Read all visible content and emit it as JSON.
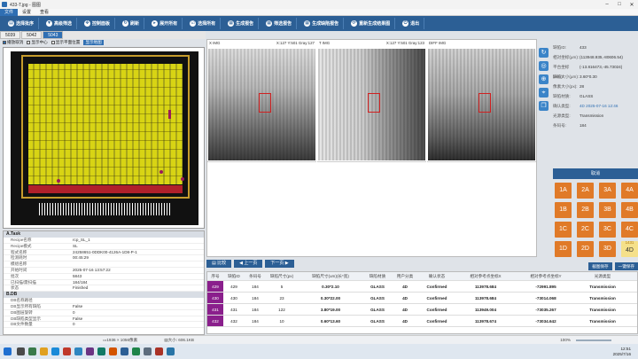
{
  "window": {
    "title": "433-T.jpg - 图图",
    "controls": [
      "–",
      "□",
      "✕"
    ]
  },
  "menu": {
    "items": [
      "文件",
      "设置",
      "查看"
    ],
    "active_index": 0
  },
  "toolbar": {
    "buttons": [
      {
        "label": "选择批序",
        "icon": "folder-icon"
      },
      {
        "label": "高级筛选",
        "icon": "filter-icon"
      },
      {
        "label": "控制面板",
        "icon": "panel-icon"
      },
      {
        "label": "刷新",
        "icon": "refresh-icon"
      },
      {
        "label": "展开所有",
        "icon": "expand-icon"
      },
      {
        "label": "选择所有",
        "icon": "select-all-icon"
      },
      {
        "label": "生成报告",
        "icon": "report-icon"
      },
      {
        "label": "筛选报告",
        "icon": "filter-report-icon"
      },
      {
        "label": "生成缺陷报告",
        "icon": "defect-report-icon"
      },
      {
        "label": "重新生成结果图",
        "icon": "regen-icon"
      },
      {
        "label": "退出",
        "icon": "exit-icon"
      }
    ]
  },
  "tabs": [
    {
      "label": "5039",
      "selected": false
    },
    {
      "label": "5042",
      "selected": false
    },
    {
      "label": "5043",
      "selected": true
    }
  ],
  "options": {
    "check_zoom": "播放取消",
    "check_center": "显示中心",
    "check_flat": "显示平面位置",
    "button_show": "显示地图"
  },
  "properties": {
    "sections": [
      {
        "title": "A.Task",
        "rows": [
          {
            "k": "Recipe名称",
            "v": "rcp_SL_1"
          },
          {
            "k": "Recipe模式",
            "v": "SL"
          },
          {
            "k": "程式名称",
            "v": "24258651-0DDK00-4126A-1D8-P-1"
          },
          {
            "k": "检测耗时",
            "v": "00:45:29"
          },
          {
            "k": "模组名称",
            "v": ""
          },
          {
            "k": "开始时间",
            "v": "2025-07-16 13:57:22"
          },
          {
            "k": "批次",
            "v": "5843"
          },
          {
            "k": "已扫描/需扫描",
            "v": "184/184"
          },
          {
            "k": "状态",
            "v": "Finished"
          }
        ]
      },
      {
        "title": "B.DB",
        "rows": [
          {
            "k": "DB名称路径",
            "v": ""
          },
          {
            "k": "DB显示所有缺陷",
            "v": "False"
          },
          {
            "k": "DB图层旋转",
            "v": "0"
          },
          {
            "k": "DB缺陷类型显示",
            "v": "False"
          },
          {
            "k": "DB文件数量",
            "v": "0"
          }
        ]
      }
    ]
  },
  "image_panel": {
    "columns": [
      {
        "label": "X IMG",
        "coord": "X:127 Y:501 Gray:127"
      },
      {
        "label": "T IMG",
        "coord": "X:127 Y:501 Gray:123"
      },
      {
        "label": "DIFF IMG",
        "coord": ""
      }
    ]
  },
  "defect_info": [
    {
      "k": "缺陷ID:",
      "v": "433"
    },
    {
      "k": "相对坐标(μm):",
      "v": "(113948.935,-80606.54)"
    },
    {
      "k": "平台坐标(mm):",
      "v": "(-13.816473,-45.73024)"
    },
    {
      "k": "缺陷大小(μm):",
      "v": "3.60*0.30"
    },
    {
      "k": "像素大小(px):",
      "v": "28"
    },
    {
      "k": "缺陷材质:",
      "v": "GLASS"
    },
    {
      "k": "确认类型:",
      "v": "4D   2025-07-16 12:46"
    },
    {
      "k": "光源类型:",
      "v": "Transmission"
    },
    {
      "k": "条码号:",
      "v": "184"
    }
  ],
  "confirm_button": "取消",
  "class_buttons": [
    "1A",
    "2A",
    "3A",
    "4A",
    "1B",
    "2B",
    "3B",
    "4B",
    "1C",
    "2C",
    "3C",
    "4C",
    "1D",
    "2D",
    "3D",
    "4D"
  ],
  "class_selected": "4D",
  "class_extra": "1431",
  "nav": {
    "compare": "比较",
    "prev": "上一页",
    "next": "下一页"
  },
  "save_buttons": {
    "save_image": "截图保存",
    "all_save": "一键保存"
  },
  "table": {
    "headers": [
      "序号",
      "缺陷ID",
      "条码号",
      "缺陷尺寸(px)",
      "缺陷尺寸(um)(长*宽)",
      "缺陷材质",
      "用户分类",
      "确认状态",
      "相对参考点坐标X",
      "相对参考点坐标Y",
      "光源类型"
    ],
    "rows": [
      [
        "429",
        "429",
        "184",
        "5",
        "0.30*2.10",
        "GLASS",
        "4D",
        "Confirmed",
        "113978.684",
        "-72991.895",
        "Transmission"
      ],
      [
        "430",
        "430",
        "184",
        "23",
        "0.30*22.00",
        "GLASS",
        "4D",
        "Confirmed",
        "113978.684",
        "-73014.068",
        "Transmission"
      ],
      [
        "431",
        "431",
        "184",
        "122",
        "3.80*19.00",
        "GLASS",
        "4D",
        "Confirmed",
        "113949.004",
        "-73035.267",
        "Transmission"
      ],
      [
        "432",
        "432",
        "184",
        "10",
        "0.60*13.60",
        "GLASS",
        "4D",
        "Confirmed",
        "113978.674",
        "-73034.642",
        "Transmission"
      ]
    ]
  },
  "status": {
    "resolution": "1936 × 1056像素",
    "size": "大小: 606.1KB",
    "zoom": "100%"
  },
  "clock": {
    "time": "12:51",
    "date": "2025/7/16"
  },
  "colors": {
    "toolbar": "#2c5f95",
    "class_button": "#e07a28",
    "selected_row": "#8a1f8c",
    "die_yellow": "#d8d414"
  }
}
